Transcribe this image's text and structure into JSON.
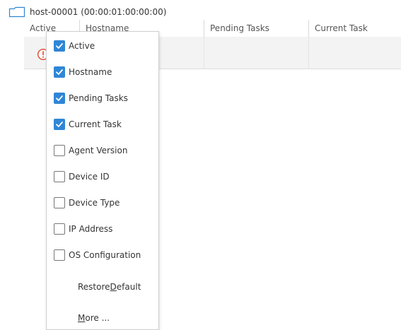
{
  "host": {
    "label": "host-00001 (00:00:01:00:00:00)"
  },
  "table": {
    "columns": [
      "Active",
      "Hostname",
      "Pending Tasks",
      "Current Task"
    ]
  },
  "menu": {
    "items": [
      {
        "label": "Active",
        "checked": true
      },
      {
        "label": "Hostname",
        "checked": true
      },
      {
        "label": "Pending Tasks",
        "checked": true
      },
      {
        "label": "Current Task",
        "checked": true
      },
      {
        "label": "Agent Version",
        "checked": false
      },
      {
        "label": "Device ID",
        "checked": false
      },
      {
        "label": "Device Type",
        "checked": false
      },
      {
        "label": "IP Address",
        "checked": false
      },
      {
        "label": "OS Configuration",
        "checked": false
      }
    ],
    "restore_default": {
      "before": "Restore ",
      "mnemonic": "D",
      "after": "efault"
    },
    "more": {
      "mnemonic": "M",
      "after": "ore ..."
    }
  },
  "icons": {
    "host": "folder-icon",
    "status": "warning-icon",
    "checkbox_checked": "checkmark-icon"
  },
  "colors": {
    "accent": "#2f86d6",
    "warning": "#e2462f"
  }
}
